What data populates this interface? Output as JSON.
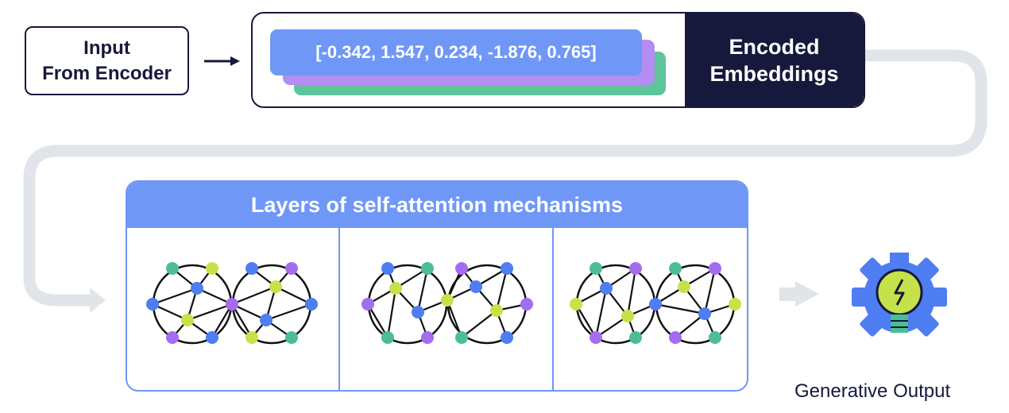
{
  "input": {
    "label": "Input\nFrom Encoder"
  },
  "embeddings": {
    "vector": "[-0.342, 1.547, 0.234, -1.876, 0.765]",
    "label": "Encoded\nEmbeddings"
  },
  "attention": {
    "title": "Layers of self-attention mechanisms"
  },
  "output": {
    "label": "Generative Output",
    "icon": "lightbulb-gear-icon"
  },
  "colors": {
    "navy": "#16193b",
    "blue": "#6f97f5",
    "purple": "#b48cf2",
    "green": "#5ec49c",
    "lime": "#c6e24a",
    "node_blue": "#4f7df2",
    "node_purple": "#a56cf0",
    "node_teal": "#4dbd96",
    "connector": "#e1e5ea"
  }
}
